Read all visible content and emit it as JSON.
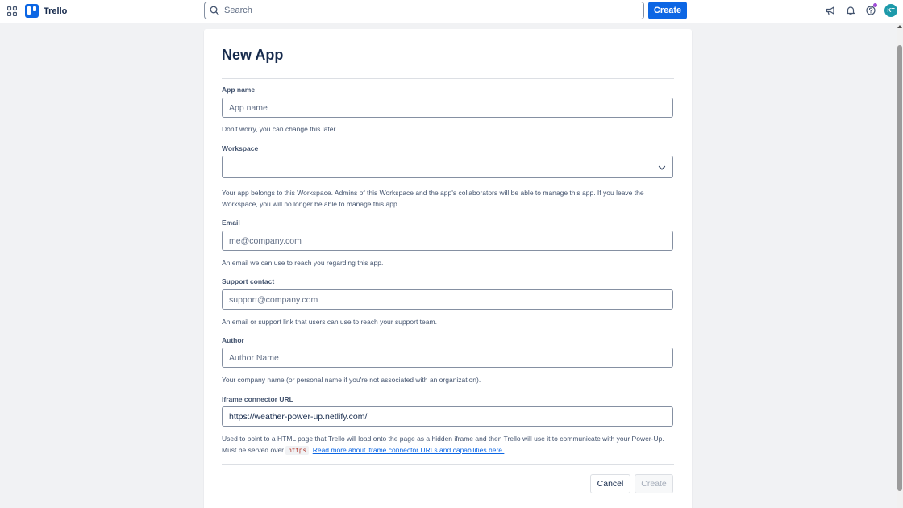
{
  "header": {
    "app_name": "Trello",
    "search_placeholder": "Search",
    "create_label": "Create",
    "avatar_initials": "KT",
    "brand_color": "#0c66e4"
  },
  "form": {
    "title": "New App",
    "app_name": {
      "label": "App name",
      "placeholder": "App name",
      "value": "",
      "helper": "Don't worry, you can change this later."
    },
    "workspace": {
      "label": "Workspace",
      "value": "",
      "helper": "Your app belongs to this Workspace. Admins of this Workspace and the app's collaborators will be able to manage this app. If you leave the Workspace, you will no longer be able to manage this app."
    },
    "email": {
      "label": "Email",
      "placeholder": "me@company.com",
      "value": "",
      "helper": "An email we can use to reach you regarding this app."
    },
    "support": {
      "label": "Support contact",
      "placeholder": "support@company.com",
      "value": "",
      "helper": "An email or support link that users can use to reach your support team."
    },
    "author": {
      "label": "Author",
      "placeholder": "Author Name",
      "value": "",
      "helper": "Your company name (or personal name if you're not associated with an organization)."
    },
    "iframe": {
      "label": "Iframe connector URL",
      "placeholder": "",
      "value": "https://weather-power-up.netlify.com/",
      "helper_prefix": "Used to point to a HTML page that Trello will load onto the page as a hidden iframe and then Trello will use it to communicate with your Power-Up. Must be served over",
      "helper_code": "https",
      "helper_sep": ".",
      "helper_link": "Read more about iframe connector URLs and capabilities here."
    },
    "cancel_label": "Cancel",
    "create_label": "Create"
  }
}
